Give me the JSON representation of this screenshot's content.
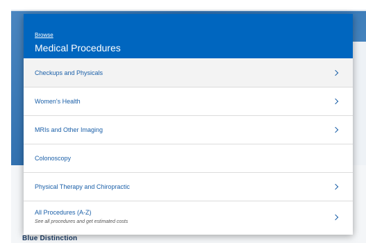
{
  "menu": {
    "breadcrumb": "Browse",
    "title": "Medical Procedures",
    "items": [
      {
        "label": "Checkups and Physicals",
        "has_chevron": true
      },
      {
        "label": "Women's Health",
        "has_chevron": true
      },
      {
        "label": "MRIs and Other Imaging",
        "has_chevron": true
      },
      {
        "label": "Colonoscopy",
        "has_chevron": false
      },
      {
        "label": "Physical Therapy and Chiropractic",
        "has_chevron": true
      },
      {
        "label": "All Procedures (A-Z)",
        "sublabel": "See all procedures and get estimated costs",
        "has_chevron": true
      }
    ]
  },
  "background": {
    "footer_text": "Blue Distinction"
  },
  "colors": {
    "header_blue": "#0066bf",
    "link_blue": "#1a5fa8",
    "hover_gray": "#f3f3f3"
  },
  "icons": {
    "item_arrow": "chevron-right-icon"
  }
}
